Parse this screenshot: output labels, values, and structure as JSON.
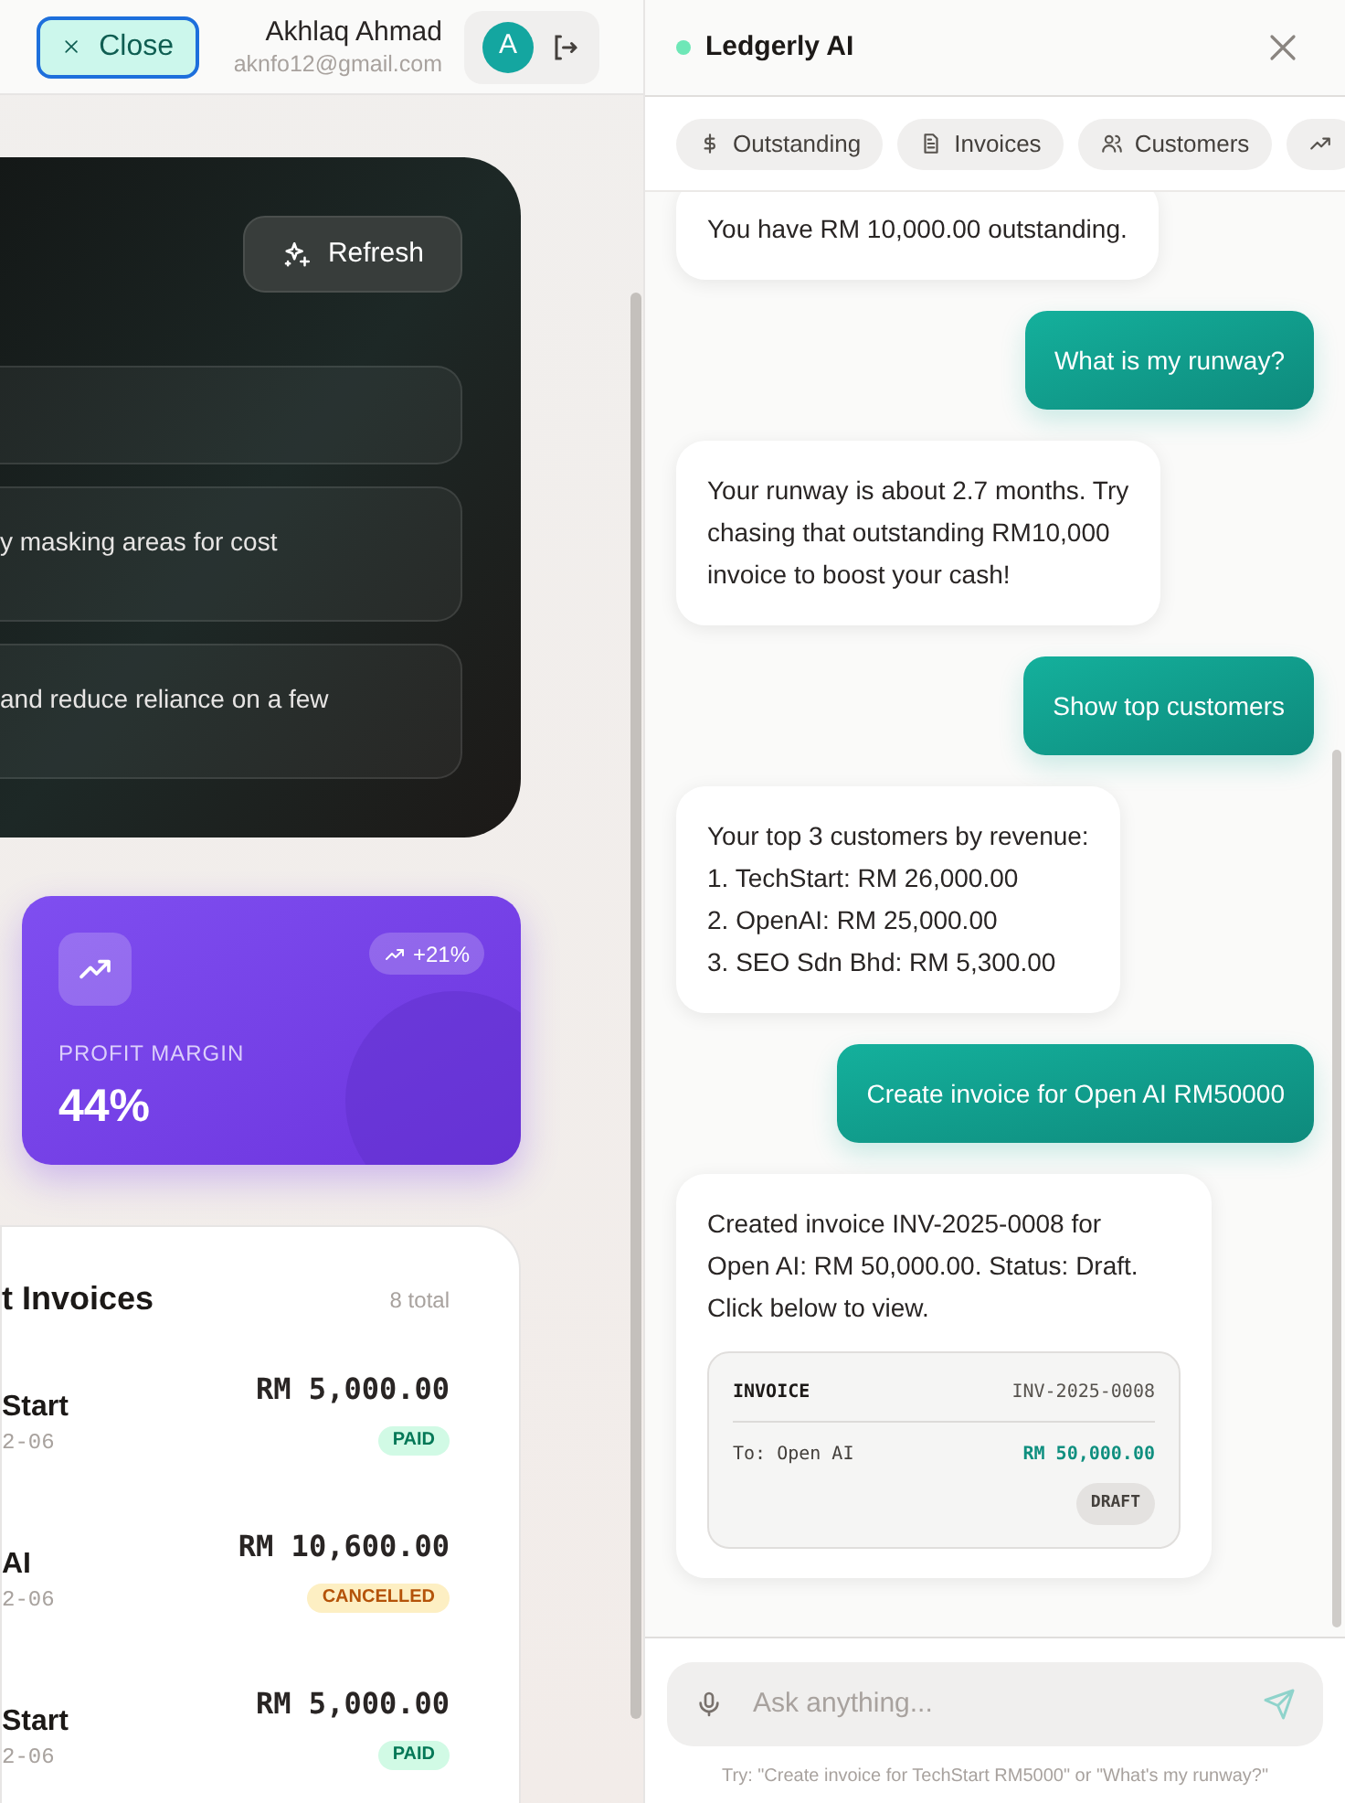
{
  "header": {
    "close_label": "Close",
    "user_name": "Akhlaq Ahmad",
    "user_email": "aknfo12@gmail.com",
    "avatar_initial": "A"
  },
  "insights_card": {
    "refresh_label": "Refresh",
    "insights": [
      {
        "kind": "blank"
      },
      {
        "kind": "text",
        "text": "y masking areas for cost"
      },
      {
        "kind": "text",
        "text": "and reduce reliance on a few"
      }
    ]
  },
  "profit_card": {
    "label": "PROFIT MARGIN",
    "value": "44%",
    "change": "+21%"
  },
  "invoices": {
    "title": "t Invoices",
    "count": "8 total",
    "rows": [
      {
        "name": "Start",
        "date": "2-06",
        "amount": "RM 5,000.00",
        "status": "PAID",
        "kind": "paid"
      },
      {
        "name": "AI",
        "date": "2-06",
        "amount": "RM 10,600.00",
        "status": "CANCELLED",
        "kind": "cancelled"
      },
      {
        "name": "Start",
        "date": "2-06",
        "amount": "RM 5,000.00",
        "status": "PAID",
        "kind": "paid"
      }
    ]
  },
  "assistant": {
    "title": "Ledgerly AI",
    "online": true,
    "chips": [
      {
        "kind": "dollar",
        "label": "Outstanding"
      },
      {
        "kind": "document",
        "label": "Invoices"
      },
      {
        "kind": "people",
        "label": "Customers"
      },
      {
        "kind": "trend"
      }
    ],
    "messages": [
      {
        "kind": "assistant",
        "text": "You have RM 10,000.00 outstanding."
      },
      {
        "kind": "user",
        "text": "What is my runway?"
      },
      {
        "kind": "assistant",
        "text": "Your runway is about 2.7 months. Try\nchasing that outstanding RM10,000\ninvoice to boost your cash!"
      },
      {
        "kind": "user",
        "text": "Show top customers"
      },
      {
        "kind": "assistant",
        "text": "Your top 3 customers by revenue:\n1. TechStart: RM 26,000.00\n2. OpenAI: RM 25,000.00\n3. SEO Sdn Bhd: RM 5,300.00"
      },
      {
        "kind": "user",
        "text": "Create invoice for Open AI RM50000"
      },
      {
        "kind": "assistant",
        "text": "Created invoice INV-2025-0008 for\nOpen AI: RM 50,000.00. Status: Draft.\nClick below to view.",
        "invoice_card": {
          "title": "INVOICE",
          "number": "INV-2025-0008",
          "recipient": "To: Open AI",
          "amount": "RM 50,000.00",
          "status": "DRAFT"
        }
      }
    ],
    "input": {
      "placeholder": "Ask anything..."
    },
    "hint": "Try: \"Create invoice for TechStart RM5000\" or \"What's my runway?\""
  }
}
